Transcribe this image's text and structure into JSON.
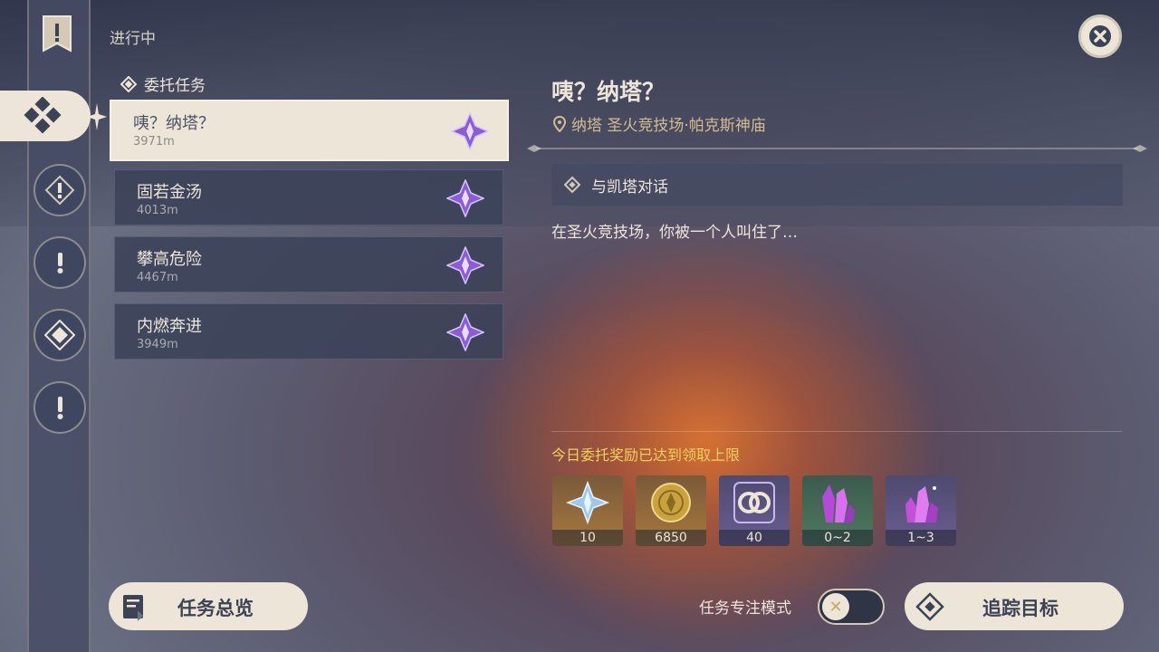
{
  "header": {
    "section": "进行中",
    "category": "委托任务"
  },
  "quests": [
    {
      "name": "咦？纳塔？",
      "distance": "3971m",
      "selected": true
    },
    {
      "name": "固若金汤",
      "distance": "4013m",
      "selected": false
    },
    {
      "name": "攀高危险",
      "distance": "4467m",
      "selected": false
    },
    {
      "name": "内燃奔进",
      "distance": "3949m",
      "selected": false
    }
  ],
  "detail": {
    "title": "咦？纳塔？",
    "location": "纳塔 圣火竞技场·帕克斯神庙",
    "objective": "与凯塔对话",
    "description": "在圣火竞技场，你被一个人叫住了…"
  },
  "rewards": {
    "notice": "今日委托奖励已达到领取上限",
    "items": [
      {
        "icon": "primogem-icon",
        "count": "10"
      },
      {
        "icon": "mora-icon",
        "count": "6850"
      },
      {
        "icon": "companionship-exp-icon",
        "count": "40"
      },
      {
        "icon": "ore-crystal-icon",
        "count": "0~2"
      },
      {
        "icon": "ore-crystal-icon",
        "count": "1~3"
      }
    ]
  },
  "footer": {
    "overview_label": "任务总览",
    "focus_mode_label": "任务专注模式",
    "focus_mode_on": false,
    "track_label": "追踪目标"
  },
  "colors": {
    "accent_cream": "#ece5d8",
    "notice_yellow": "#f1d25b",
    "location_gold": "#d3bc8e",
    "quest_purple": "#8a5cd6"
  }
}
